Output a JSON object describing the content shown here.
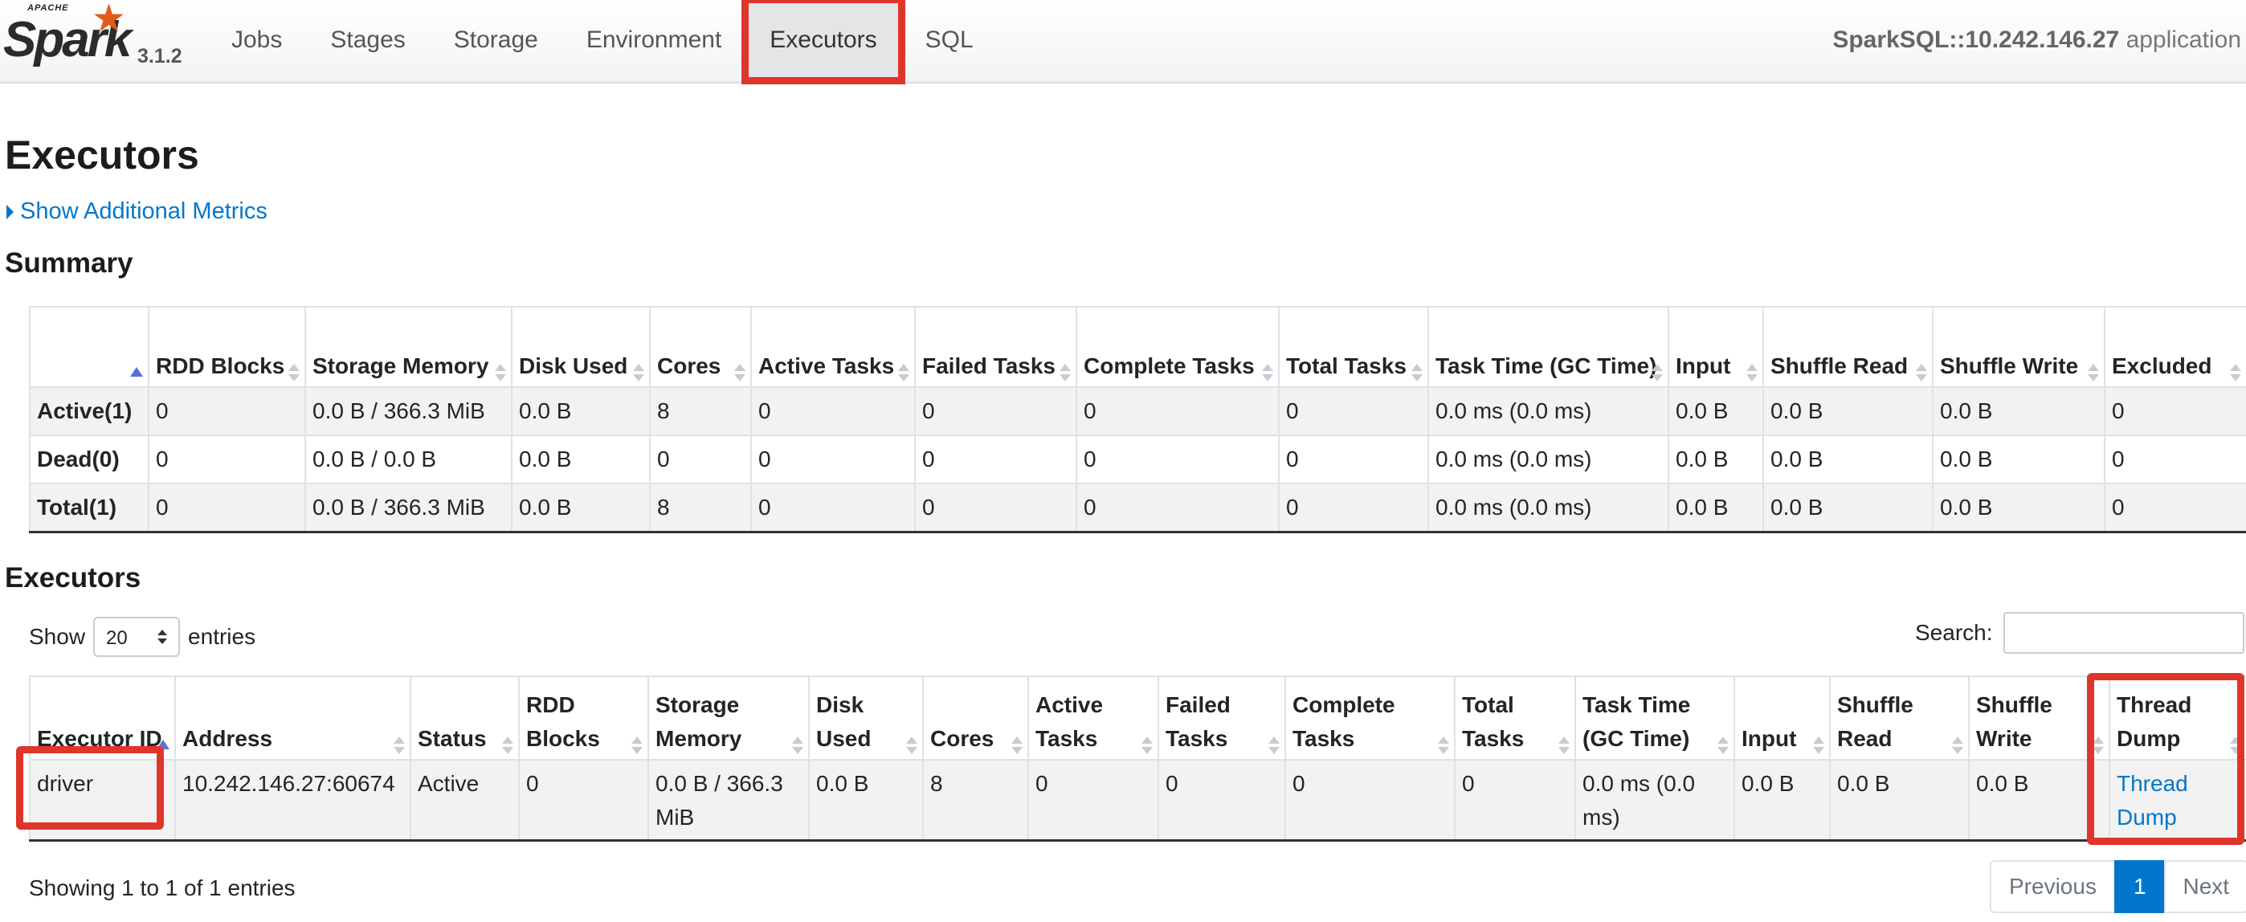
{
  "nav": {
    "logo_small": "APACHE",
    "logo_text": "Spark",
    "version": "3.1.2",
    "tabs": [
      "Jobs",
      "Stages",
      "Storage",
      "Environment",
      "Executors",
      "SQL"
    ],
    "active_tab": "Executors",
    "app_title": "SparkSQL::10.242.146.27",
    "app_suffix": "application"
  },
  "page": {
    "title": "Executors",
    "additional_metrics": "Show Additional Metrics",
    "summary_heading": "Summary",
    "executors_heading": "Executors"
  },
  "summary": {
    "columns": [
      "",
      "RDD Blocks",
      "Storage Memory",
      "Disk Used",
      "Cores",
      "Active Tasks",
      "Failed Tasks",
      "Complete Tasks",
      "Total Tasks",
      "Task Time (GC Time)",
      "Input",
      "Shuffle Read",
      "Shuffle Write",
      "Excluded"
    ],
    "rows": [
      [
        "Active(1)",
        "0",
        "0.0 B / 366.3 MiB",
        "0.0 B",
        "8",
        "0",
        "0",
        "0",
        "0",
        "0.0 ms (0.0 ms)",
        "0.0 B",
        "0.0 B",
        "0.0 B",
        "0"
      ],
      [
        "Dead(0)",
        "0",
        "0.0 B / 0.0 B",
        "0.0 B",
        "0",
        "0",
        "0",
        "0",
        "0",
        "0.0 ms (0.0 ms)",
        "0.0 B",
        "0.0 B",
        "0.0 B",
        "0"
      ],
      [
        "Total(1)",
        "0",
        "0.0 B / 366.3 MiB",
        "0.0 B",
        "8",
        "0",
        "0",
        "0",
        "0",
        "0.0 ms (0.0 ms)",
        "0.0 B",
        "0.0 B",
        "0.0 B",
        "0"
      ]
    ]
  },
  "executors": {
    "show_label": "Show",
    "page_size": "20",
    "entries_label": "entries",
    "search_label": "Search:",
    "search_value": "",
    "columns": [
      "Executor ID",
      "Address",
      "Status",
      "RDD Blocks",
      "Storage Memory",
      "Disk Used",
      "Cores",
      "Active Tasks",
      "Failed Tasks",
      "Complete Tasks",
      "Total Tasks",
      "Task Time (GC Time)",
      "Input",
      "Shuffle Read",
      "Shuffle Write",
      "Thread Dump"
    ],
    "rows": [
      [
        "driver",
        "10.242.146.27:60674",
        "Active",
        "0",
        "0.0 B / 366.3 MiB",
        "0.0 B",
        "8",
        "0",
        "0",
        "0",
        "0",
        "0.0 ms (0.0 ms)",
        "0.0 B",
        "0.0 B",
        "0.0 B",
        "Thread Dump"
      ]
    ],
    "showing": "Showing 1 to 1 of 1 entries",
    "pager": {
      "previous": "Previous",
      "current": "1",
      "next": "Next"
    }
  },
  "colors": {
    "accent": "#0077cc",
    "highlight": "#e0352b",
    "spark_orange": "#e25a1c"
  }
}
